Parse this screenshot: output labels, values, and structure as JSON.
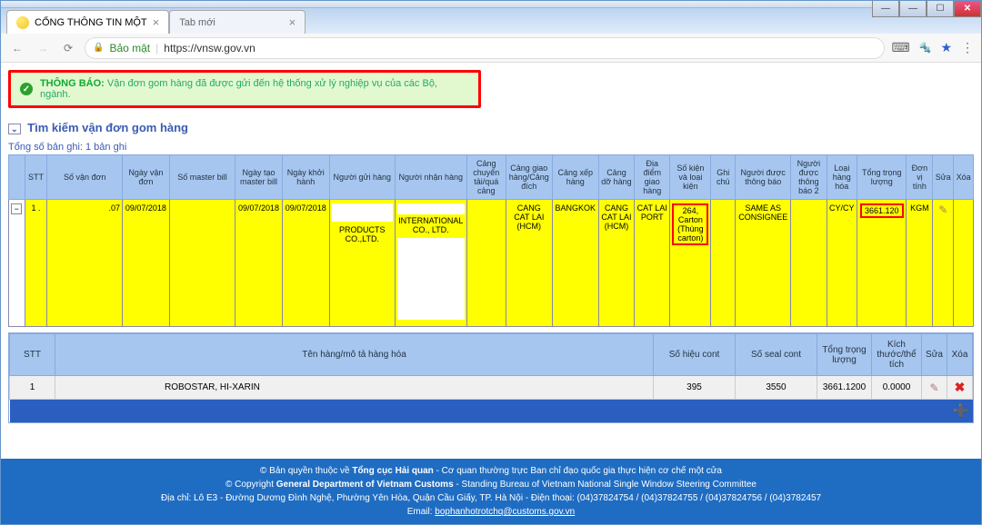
{
  "browser": {
    "tab1_title": "CỔNG THÔNG TIN MỘT",
    "tab2_title": "Tab mới",
    "secure_label": "Bảo mật",
    "url": "https://vnsw.gov.vn"
  },
  "alert": {
    "label": "THÔNG BÁO:",
    "message": "Vận đơn gom hàng đã được gửi đến hệ thống xử lý nghiệp vụ của các Bộ, ngành."
  },
  "page_title": "Tìm kiếm vận đơn gom hàng",
  "record_count": "Tổng số bản ghi: 1 bản ghi",
  "headers": {
    "c0": "",
    "c1": "STT",
    "c2": "Số vận đơn",
    "c3": "Ngày vận đơn",
    "c4": "Số master bill",
    "c5": "Ngày tạo master bill",
    "c6": "Ngày khởi hành",
    "c7": "Người gửi hàng",
    "c8": "Người nhận hàng",
    "c9": "Cảng chuyển tải/quá cảng",
    "c10": "Cảng giao hàng/Cảng đích",
    "c11": "Cảng xếp hàng",
    "c12": "Cảng dỡ hàng",
    "c13": "Địa điểm giao hàng",
    "c14": "Số kiện và loại kiện",
    "c15": "Ghi chú",
    "c16": "Người được thông báo",
    "c17": "Người được thông báo 2",
    "c18": "Loại hàng hóa",
    "c19": "Tổng trọng lượng",
    "c20": "Đơn vị tính",
    "c21": "Sửa",
    "c22": "Xóa"
  },
  "row": {
    "stt": "1 .",
    "so_van_don": ".07",
    "ngay_van_don": "09/07/2018",
    "so_master": "",
    "ngay_tao_master": "09/07/2018",
    "ngay_khoi_hanh": "09/07/2018",
    "nguoi_gui": "PRODUCTS CO.,LTD.",
    "nguoi_nhan": "INTERNATIONAL CO., LTD.",
    "cang_chuyen_tai": "",
    "cang_giao": "CANG CAT LAI (HCM)",
    "cang_xep": "BANGKOK",
    "cang_do": "CANG CAT LAI (HCM)",
    "dia_diem_giao": "CAT LAI PORT",
    "so_kien": "264, Carton (Thùng carton)",
    "ghi_chu": "",
    "thong_bao": "SAME AS CONSIGNEE",
    "thong_bao2": "",
    "loai_hang": "CY/CY",
    "tong_trong_luong": "3661.120",
    "don_vi": "KGM"
  },
  "sub_headers": {
    "stt": "STT",
    "ten_hang": "Tên hàng/mô tả hàng hóa",
    "so_hieu": "Số hiệu cont",
    "so_seal": "Số seal cont",
    "trong_luong": "Tổng trọng lượng",
    "kich_thuoc": "Kích thước/thể tích",
    "sua": "Sửa",
    "xoa": "Xóa"
  },
  "sub_row": {
    "stt": "1",
    "ten_hang": "ROBOSTAR, HI-XARIN",
    "so_hieu": "395",
    "so_seal": "3550",
    "trong_luong": "3661.1200",
    "kich_thuoc": "0.0000"
  },
  "footer": {
    "line1_a": "© Bản quyền thuộc về ",
    "line1_b": "Tổng cục Hải quan",
    "line1_c": " - Cơ quan thường trực Ban chỉ đạo quốc gia thực hiện cơ chế một cửa",
    "line2_a": "© Copyright ",
    "line2_b": "General Department of Vietnam Customs",
    "line2_c": " - Standing Bureau of Vietnam National Single Window Steering Committee",
    "line3": "Địa chỉ: Lô E3 - Đường Dương Đình Nghệ, Phường Yên Hòa, Quận Cầu Giấy, TP. Hà Nội - Điện thoại: (04)37824754 / (04)37824755 / (04)37824756 / (04)3782457",
    "line4_a": "Email: ",
    "line4_b": "bophanhotrotchq@customs.gov.vn"
  }
}
